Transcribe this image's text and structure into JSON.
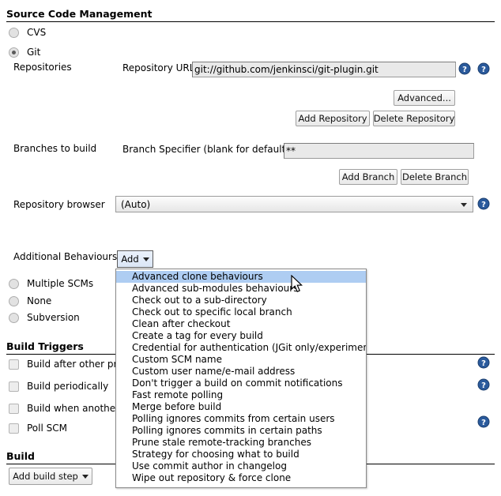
{
  "sections": {
    "scm_title": "Source Code Management",
    "build_triggers_title": "Build Triggers",
    "build_title": "Build"
  },
  "scm": {
    "options": [
      {
        "label": "CVS",
        "checked": false
      },
      {
        "label": "Git",
        "checked": true
      }
    ],
    "repositories_label": "Repositories",
    "repository_url_label": "Repository URL",
    "repository_url_value": "git://github.com/jenkinsci/git-plugin.git",
    "advanced_button": "Advanced...",
    "add_repository_button": "Add Repository",
    "delete_repository_button": "Delete Repository",
    "branches_label": "Branches to build",
    "branch_specifier_label": "Branch Specifier (blank for default)",
    "branch_specifier_value": "**",
    "add_branch_button": "Add Branch",
    "delete_branch_button": "Delete Branch",
    "repository_browser_label": "Repository browser",
    "repository_browser_value": "(Auto)",
    "additional_behaviours_label": "Additional Behaviours",
    "add_button": "Add",
    "other_scm_options": [
      {
        "label": "Multiple SCMs",
        "checked": false
      },
      {
        "label": "None",
        "checked": false
      },
      {
        "label": "Subversion",
        "checked": false
      }
    ]
  },
  "behaviours_menu": {
    "items": [
      "Advanced clone behaviours",
      "Advanced sub-modules behaviours",
      "Check out to a sub-directory",
      "Check out to specific local branch",
      "Clean after checkout",
      "Create a tag for every build",
      "Credential for authentication (JGit only/experimental)",
      "Custom SCM name",
      "Custom user name/e-mail address",
      "Don't trigger a build on commit notifications",
      "Fast remote polling",
      "Merge before build",
      "Polling ignores commits from certain users",
      "Polling ignores commits in certain paths",
      "Prune stale remote-tracking branches",
      "Strategy for choosing what to build",
      "Use commit author in changelog",
      "Wipe out repository & force clone"
    ],
    "highlighted_index": 0
  },
  "build_triggers": {
    "items": [
      {
        "label": "Build after other pro",
        "checked": false
      },
      {
        "label": "Build periodically",
        "checked": false
      },
      {
        "label": "Build when another",
        "checked": false
      },
      {
        "label": "Poll SCM",
        "checked": false
      }
    ]
  },
  "build": {
    "add_build_step_button": "Add build step"
  },
  "colors": {
    "highlight": "#aecdf2",
    "help_icon": "#2a5a9c",
    "border": "#898989"
  }
}
